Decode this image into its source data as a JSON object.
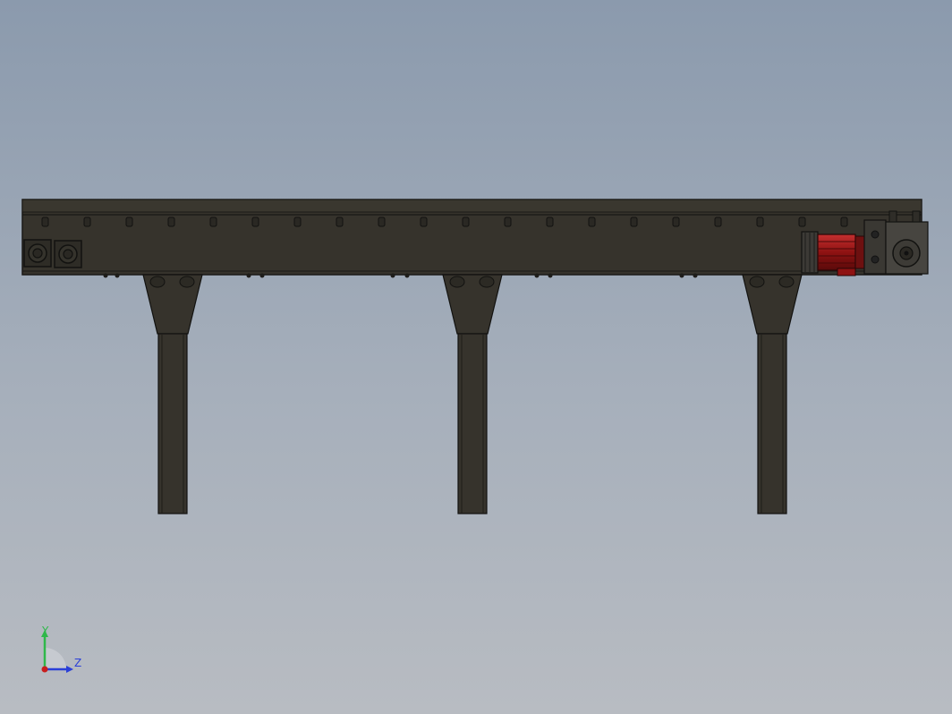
{
  "view": {
    "background_top": "#8b9aad",
    "background_bottom": "#b8bcc2",
    "model_color": "#35332c",
    "motor_color": "#a11818"
  },
  "triad": {
    "y_label": "Y",
    "z_label": "Z",
    "y_color": "#2fb84a",
    "z_color": "#2a3fd8",
    "origin_color": "#c81e1e"
  }
}
